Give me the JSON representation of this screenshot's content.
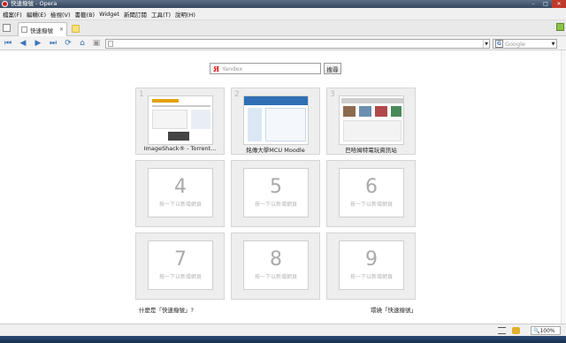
{
  "window": {
    "title": "快速撥號 - Opera"
  },
  "menu": [
    "檔案(F)",
    "編輯(E)",
    "檢視(V)",
    "書籤(B)",
    "Widget",
    "新聞訂閱",
    "工具(T)",
    "說明(H)"
  ],
  "tabs": [
    {
      "label": "快速撥號"
    }
  ],
  "search": {
    "engine_placeholder": "Google"
  },
  "yandex": {
    "placeholder": "Yandex",
    "button": "搜尋"
  },
  "speed_dial": [
    {
      "number": "1",
      "caption": "ImageShack® - Torrent...",
      "filled": true
    },
    {
      "number": "2",
      "caption": "銘傳大學MCU Moodle",
      "filled": true
    },
    {
      "number": "3",
      "caption": "巴哈姆特電玩資訊站",
      "filled": true
    },
    {
      "number": "4",
      "hint": "按一下以新增網頁",
      "filled": false
    },
    {
      "number": "5",
      "hint": "按一下以新增網頁",
      "filled": false
    },
    {
      "number": "6",
      "hint": "按一下以新增網頁",
      "filled": false
    },
    {
      "number": "7",
      "hint": "按一下以新增網頁",
      "filled": false
    },
    {
      "number": "8",
      "hint": "按一下以新增網頁",
      "filled": false
    },
    {
      "number": "9",
      "hint": "按一下以新增網頁",
      "filled": false
    }
  ],
  "footer": {
    "left_link": "什麼是「快速撥號」?",
    "right_link": "環繞「快速撥號」"
  },
  "status": {
    "zoom": "100%"
  },
  "colors": {
    "accent": "#3b73b9",
    "titlebar": "#34475e",
    "dial_bg": "#eeeeee"
  }
}
